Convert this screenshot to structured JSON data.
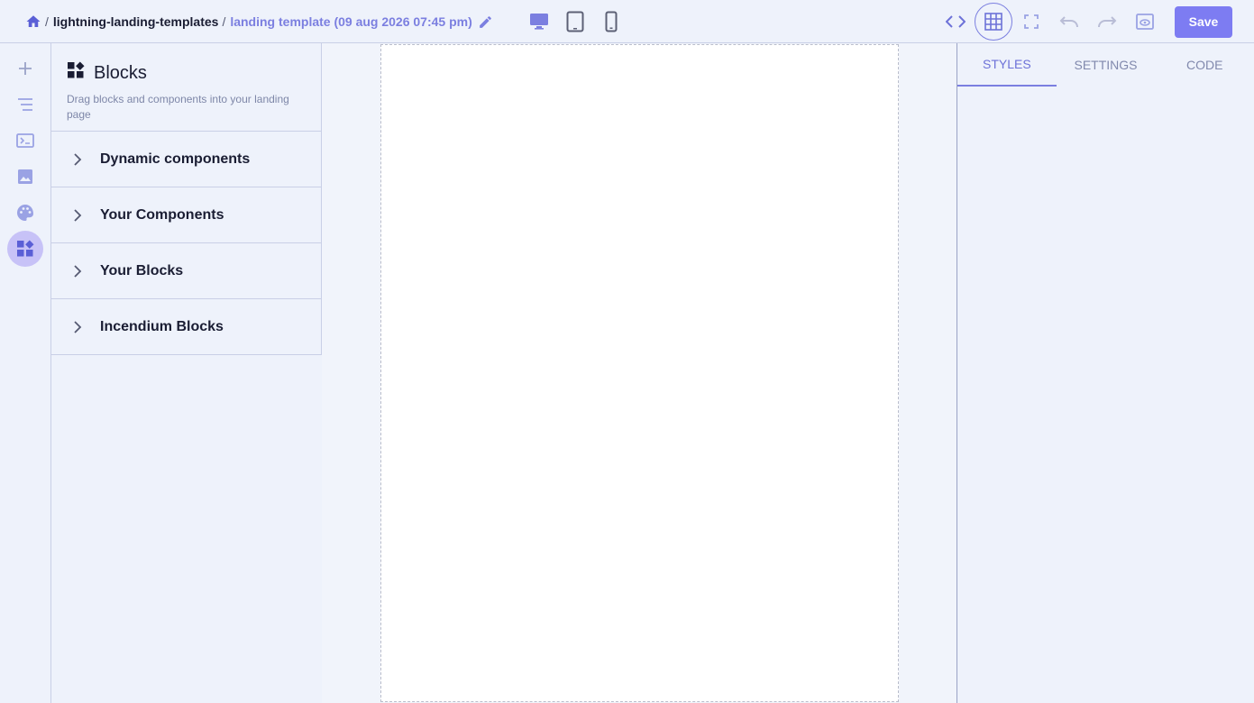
{
  "breadcrumb": {
    "home_icon": "home-icon",
    "separator": "/",
    "project": "lightning-landing-templates",
    "page": "landing template (09 aug 2026 07:45 pm)",
    "edit_icon": "pencil-icon"
  },
  "devices": [
    {
      "name": "desktop-icon",
      "active": true
    },
    {
      "name": "tablet-icon",
      "active": false
    },
    {
      "name": "mobile-icon",
      "active": false
    }
  ],
  "toolbar": {
    "icons": [
      "code-icon",
      "grid-icon",
      "fullscreen-icon",
      "undo-icon",
      "redo-icon",
      "preview-icon"
    ],
    "save_label": "Save"
  },
  "rail": {
    "icons": [
      "plus-icon",
      "layers-icon",
      "terminal-icon",
      "image-icon",
      "palette-icon",
      "blocks-icon"
    ],
    "active": "blocks-icon"
  },
  "blocks_panel": {
    "title": "Blocks",
    "description": "Drag blocks and components into your landing page",
    "sections": [
      {
        "label": "Dynamic components"
      },
      {
        "label": "Your Components"
      },
      {
        "label": "Your Blocks"
      },
      {
        "label": "Incendium Blocks"
      }
    ]
  },
  "right_panel": {
    "tabs": [
      {
        "label": "STYLES",
        "active": true
      },
      {
        "label": "SETTINGS",
        "active": false
      },
      {
        "label": "CODE",
        "active": false
      }
    ]
  },
  "colors": {
    "accent": "#7d7cf2",
    "accent_text": "#7b7fe0",
    "background": "#eef2fb",
    "border": "#c9cfe6"
  }
}
